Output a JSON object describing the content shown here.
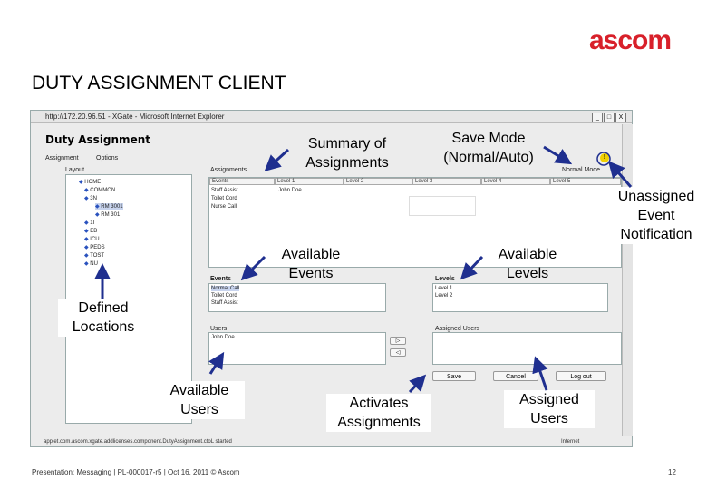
{
  "brand": {
    "logo": "ascom"
  },
  "slide": {
    "title": "DUTY ASSIGNMENT CLIENT",
    "footer": "Presentation: Messaging | PL-000017-r5 | Oct 16, 2011 © Ascom",
    "page": "12"
  },
  "window": {
    "title": "http://172.20.96.51 - XGate - Microsoft Internet Explorer",
    "controls": [
      "_",
      "□",
      "X"
    ],
    "status_url": "applet.com.ascom.xgate.addlicenses.component.DutyAssignment.ctoL started",
    "status_zone": "Internet"
  },
  "app": {
    "heading": "Duty Assignment",
    "menu": [
      "Assignment",
      "Options"
    ],
    "mode_label": "Normal Mode",
    "layout_label": "Layout",
    "tree": [
      "HOME",
      "COMMON",
      "3N",
      "RM 3001",
      "RM 301",
      "1I",
      "EB",
      "ICU",
      "PEDS",
      "TOST",
      "NU"
    ],
    "assignments_label": "Assignments",
    "assignments_columns": [
      "Events",
      "Level 1",
      "Level 2",
      "Level 3",
      "Level 4",
      "Level 5"
    ],
    "assignments_rows": [
      {
        "event": "Staff Assist",
        "level1": "John Doe"
      },
      {
        "event": "Toilet Cord",
        "level1": ""
      },
      {
        "event": "Nurse Call",
        "level1": ""
      }
    ],
    "events_label": "Events",
    "events": [
      "Normal Call",
      "Toilet Cord",
      "Staff Assist"
    ],
    "levels_label": "Levels",
    "levels": [
      "Level 1",
      "Level 2"
    ],
    "users_label": "Users",
    "users": [
      "John Doe"
    ],
    "assigned_users_label": "Assigned Users",
    "transfer_right": "▷",
    "transfer_left": "◁",
    "save_button": "Save",
    "cancel_button": "Cancel",
    "logout_button": "Log out",
    "notification_glyph": "!"
  },
  "callouts": {
    "summary": "Summary of\nAssignments",
    "save_mode": "Save Mode\n(Normal/Auto)",
    "unassigned": "Unassigned\nEvent\nNotification",
    "available_events": "Available\nEvents",
    "available_levels": "Available\nLevels",
    "defined_locations": "Defined\nLocations",
    "available_users": "Available\nUsers",
    "activates": "Activates\nAssignments",
    "assigned_users": "Assigned\nUsers"
  },
  "colors": {
    "logo": "#d8202a",
    "arrow": "#1f2f8f",
    "notify": "#f0d000"
  }
}
